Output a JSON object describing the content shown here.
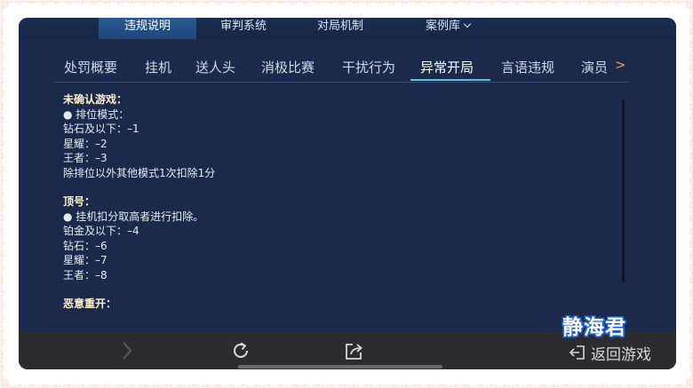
{
  "top_nav": {
    "items": [
      {
        "label": "违规说明",
        "active": true
      },
      {
        "label": "审判系统",
        "active": false
      },
      {
        "label": "对局机制",
        "active": false
      },
      {
        "label": "案例库",
        "active": false,
        "has_dropdown": true
      }
    ]
  },
  "category_tabs": {
    "items": [
      "处罚概要",
      "挂机",
      "送人头",
      "消极比赛",
      "干扰行为",
      "异常开局",
      "言语违规",
      "演员"
    ],
    "active": "异常开局",
    "more_arrow": ">"
  },
  "content": {
    "sections": [
      {
        "heading": "未确认游戏：",
        "lines": [
          "●  排位模式：",
          "钻石及以下：–1",
          "星耀：–2",
          "王者：–3",
          "除排位以外其他模式1次扣除1分"
        ]
      },
      {
        "heading": "顶号：",
        "lines": [
          "●  挂机扣分取高者进行扣除。",
          "铂金及以下：–4",
          "钻石：–6",
          "星耀：–7",
          "王者：–8"
        ]
      },
      {
        "heading": "恶意重开：",
        "lines": []
      }
    ]
  },
  "toolbar": {
    "forward_icon": "chevron-right-icon",
    "refresh_icon": "refresh-icon",
    "share_icon": "share-icon",
    "return_label": "返回游戏",
    "return_icon": "exit-icon"
  },
  "watermark": {
    "text": "静海君"
  },
  "colors": {
    "background": "#1b2a4a",
    "active_tab_underline": "#5ec2ea",
    "heading_text": "#fff2cc",
    "toolbar": "#2c2c2e",
    "more_arrow": "#d8a35a",
    "watermark_outline": "#1d5fc9"
  }
}
